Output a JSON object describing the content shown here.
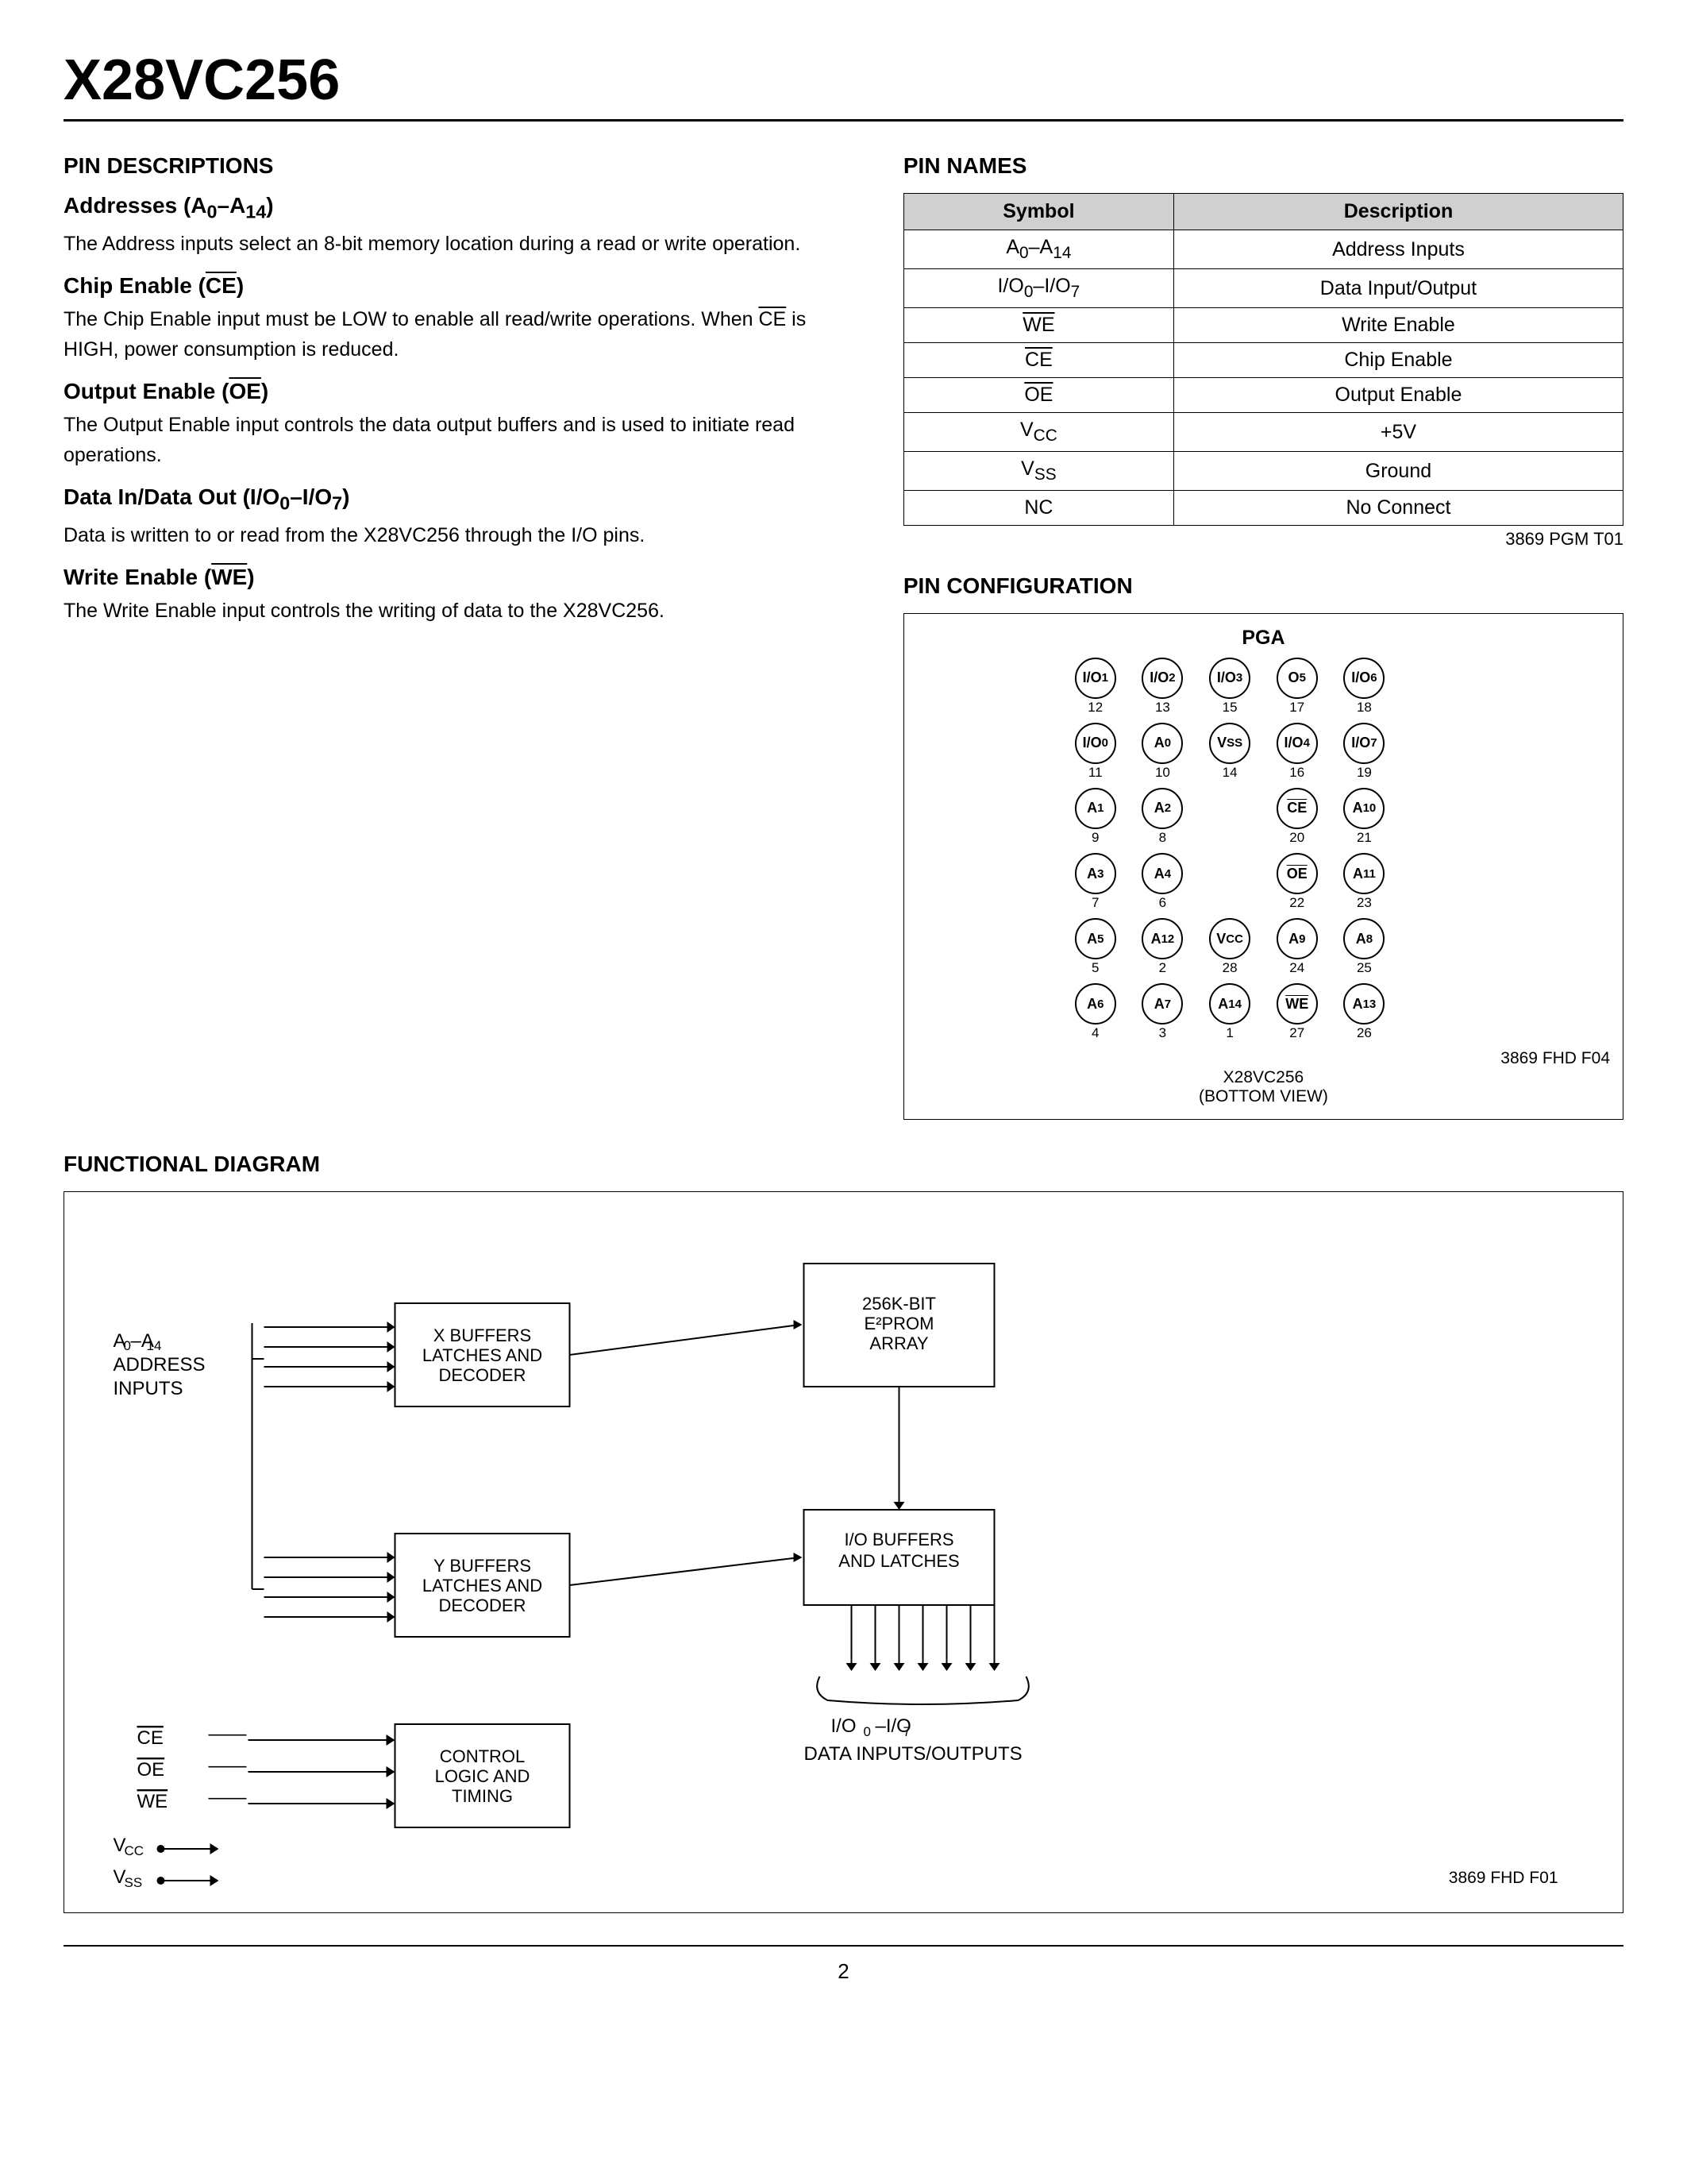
{
  "title": "X28VC256",
  "left_col": {
    "pin_descriptions_heading": "PIN DESCRIPTIONS",
    "sections": [
      {
        "id": "addresses",
        "heading": "Addresses (A",
        "heading_sub": "0",
        "heading_mid": "–A",
        "heading_sub2": "14",
        "heading_suffix": ")",
        "body": "The Address inputs select an 8-bit memory location during a read or write operation."
      },
      {
        "id": "chip_enable",
        "heading": "Chip Enable (",
        "heading_overline": "CE",
        "heading_suffix": ")",
        "body": "The Chip Enable input must be LOW to enable all read/write operations. When CE is HIGH, power consumption is reduced."
      },
      {
        "id": "output_enable",
        "heading": "Output Enable (",
        "heading_overline": "OE",
        "heading_suffix": ")",
        "body": "The Output Enable input controls the data output buffers and is used to initiate read operations."
      },
      {
        "id": "data_io",
        "heading": "Data In/Data Out (I/O",
        "heading_sub": "0",
        "heading_mid": "–I/O",
        "heading_sub2": "7",
        "heading_suffix": ")",
        "body": "Data is written to or read from the X28VC256 through the I/O pins."
      },
      {
        "id": "write_enable",
        "heading": "Write Enable (",
        "heading_overline": "WE",
        "heading_suffix": ")",
        "body": "The Write Enable input controls the writing of data to the X28VC256."
      }
    ]
  },
  "right_col": {
    "pin_names_heading": "PIN NAMES",
    "table": {
      "headers": [
        "Symbol",
        "Description"
      ],
      "rows": [
        [
          "A₀–A₁₄",
          "Address Inputs"
        ],
        [
          "I/O₀–I/O₇",
          "Data Input/Output"
        ],
        [
          "WE̅",
          "Write Enable"
        ],
        [
          "CE̅",
          "Chip Enable"
        ],
        [
          "OE̅",
          "Output Enable"
        ],
        [
          "Vᴄᴄ",
          "+5V"
        ],
        [
          "VSS",
          "Ground"
        ],
        [
          "NC",
          "No Connect"
        ]
      ]
    },
    "table_note": "3869 PGM T01",
    "pin_config_heading": "PIN CONFIGURATION",
    "pga_label": "PGA",
    "pin_config_note": "3869 FHD F04",
    "pin_config_bottom": "X28VC256\n(BOTTOM VIEW)"
  },
  "functional_diagram": {
    "heading": "FUNCTIONAL DIAGRAM",
    "blocks": {
      "x_buffers": "X BUFFERS\nLATCHES AND\nDECODER",
      "y_buffers": "Y BUFFERS\nLATCHES AND\nDECODER",
      "eprom": "256K-BIT\nE²PROM\nARRAY",
      "io_buffers": "I/O BUFFERS\nAND LATCHES",
      "control": "CONTROL\nLOGIC AND\nTIMING"
    },
    "labels": {
      "address_inputs": "A₀–A₁₄\nADDRESS\nINPUTS",
      "io_data": "I/O₀–I/O₇\nDATA INPUTS/OUTPUTS",
      "ce": "CE̅",
      "oe": "OE̅",
      "we": "WE̅",
      "vcc": "VCC",
      "vss": "VSS"
    },
    "note": "3869 FHD F01"
  },
  "footer": {
    "page_number": "2"
  }
}
